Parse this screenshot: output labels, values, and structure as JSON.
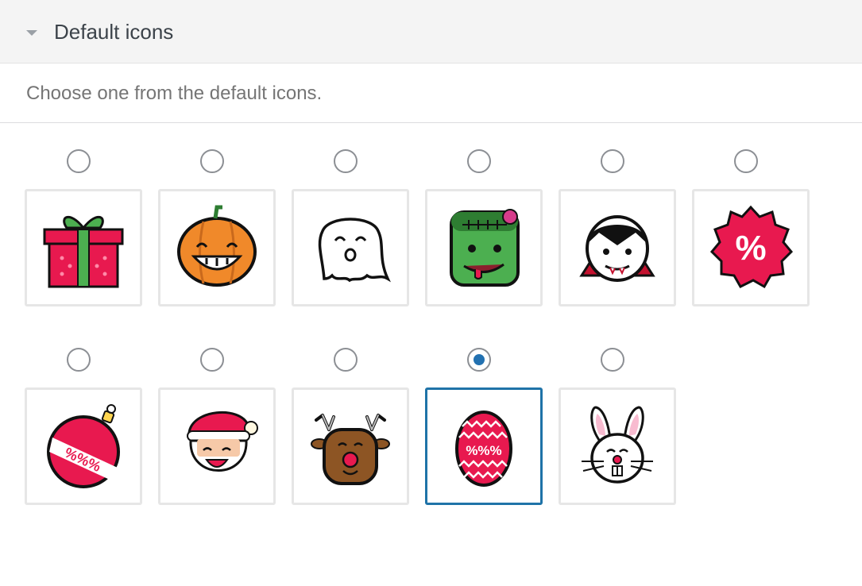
{
  "panel": {
    "title": "Default icons"
  },
  "description": "Choose one from the default icons.",
  "colors": {
    "selected_accent": "#2271b1",
    "selected_border": "#1f73a8"
  },
  "icons": [
    {
      "name": "gift-icon",
      "selected": false
    },
    {
      "name": "pumpkin-icon",
      "selected": false
    },
    {
      "name": "ghost-icon",
      "selected": false
    },
    {
      "name": "zombie-icon",
      "selected": false
    },
    {
      "name": "vampire-icon",
      "selected": false
    },
    {
      "name": "percent-badge-icon",
      "selected": false,
      "label": "%"
    },
    {
      "name": "ornament-icon",
      "selected": false,
      "label": "%%%"
    },
    {
      "name": "santa-icon",
      "selected": false
    },
    {
      "name": "reindeer-icon",
      "selected": false
    },
    {
      "name": "easter-egg-icon",
      "selected": true,
      "label": "%%%"
    },
    {
      "name": "bunny-icon",
      "selected": false
    }
  ]
}
